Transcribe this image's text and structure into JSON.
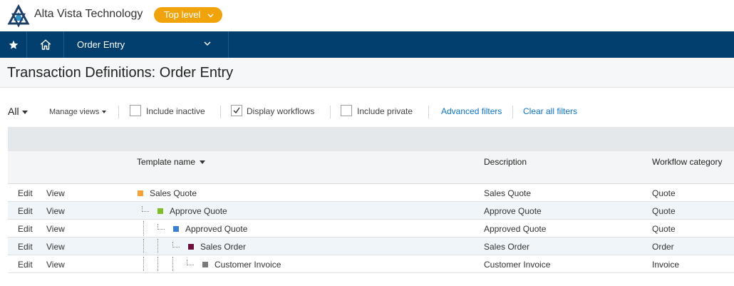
{
  "company": {
    "name": "Alta Vista Technology",
    "level_label": "Top level"
  },
  "nav": {
    "module_label": "Order Entry"
  },
  "page": {
    "title": "Transaction Definitions: Order Entry"
  },
  "filters": {
    "all_label": "All",
    "manage_views": "Manage views",
    "include_inactive": {
      "label": "Include inactive",
      "checked": false
    },
    "display_workflows": {
      "label": "Display workflows",
      "checked": true
    },
    "include_private": {
      "label": "Include private",
      "checked": false
    },
    "advanced_filters": "Advanced filters",
    "clear_filters": "Clear all filters"
  },
  "table": {
    "columns": {
      "template_name": "Template name",
      "description": "Description",
      "workflow_category": "Workflow category"
    },
    "actions": {
      "edit": "Edit",
      "view": "View"
    },
    "rows": [
      {
        "template": "Sales Quote",
        "description": "Sales Quote",
        "category": "Quote",
        "depth": 0,
        "color": "#f7a233"
      },
      {
        "template": "Approve Quote",
        "description": "Approve Quote",
        "category": "Quote",
        "depth": 1,
        "color": "#7cc128"
      },
      {
        "template": "Approved Quote",
        "description": "Approved Quote",
        "category": "Quote",
        "depth": 2,
        "color": "#3b7fd0"
      },
      {
        "template": "Sales Order",
        "description": "Sales Order",
        "category": "Order",
        "depth": 3,
        "color": "#6b0f3d"
      },
      {
        "template": "Customer Invoice",
        "description": "Customer Invoice",
        "category": "Invoice",
        "depth": 4,
        "color": "#7b7b7b"
      }
    ]
  },
  "colors": {
    "nav_bg": "#033f6e",
    "accent": "#f0a30a",
    "link": "#0a74c4"
  }
}
